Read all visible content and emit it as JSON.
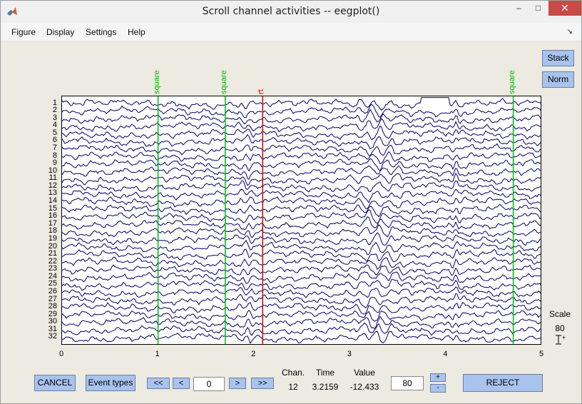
{
  "window": {
    "title": "Scroll channel activities -- eegplot()",
    "minimize": "–",
    "maximize": "□",
    "close": "✕"
  },
  "menu": {
    "items": [
      "Figure",
      "Display",
      "Settings",
      "Help"
    ],
    "dock_arrow": "↘"
  },
  "side_buttons": {
    "stack": "Stack",
    "norm": "Norm"
  },
  "events": [
    {
      "label": "square",
      "time": 1.0,
      "color": "#00bb00"
    },
    {
      "label": "square",
      "time": 1.7,
      "color": "#00bb00"
    },
    {
      "label": "rt",
      "time": 2.09,
      "color": "#cc0000"
    },
    {
      "label": "square",
      "time": 4.7,
      "color": "#00bb00"
    }
  ],
  "channels": [
    "1",
    "2",
    "3",
    "4",
    "5",
    "6",
    "7",
    "8",
    "9",
    "10",
    "11",
    "12",
    "13",
    "14",
    "15",
    "16",
    "17",
    "18",
    "19",
    "20",
    "21",
    "22",
    "23",
    "24",
    "25",
    "26",
    "27",
    "28",
    "29",
    "30",
    "31",
    "32"
  ],
  "x_axis": {
    "ticks": [
      "0",
      "1",
      "2",
      "3",
      "4",
      "5"
    ],
    "min": 0,
    "max": 5
  },
  "scale": {
    "label": "Scale",
    "value": "80",
    "marker": "+"
  },
  "trace_color": "#00006a",
  "controls": {
    "cancel": "CANCEL",
    "event_types": "Event types",
    "prev_page": "<<",
    "prev": "<",
    "position": "0",
    "next": ">",
    "next_page": ">>",
    "chan_label": "Chan.",
    "chan_value": "12",
    "time_label": "Time",
    "time_value": "3.2159",
    "value_label": "Value",
    "value_value": "-12.433",
    "scale_value": "80",
    "plus": "+",
    "minus": "-",
    "reject": "REJECT"
  }
}
